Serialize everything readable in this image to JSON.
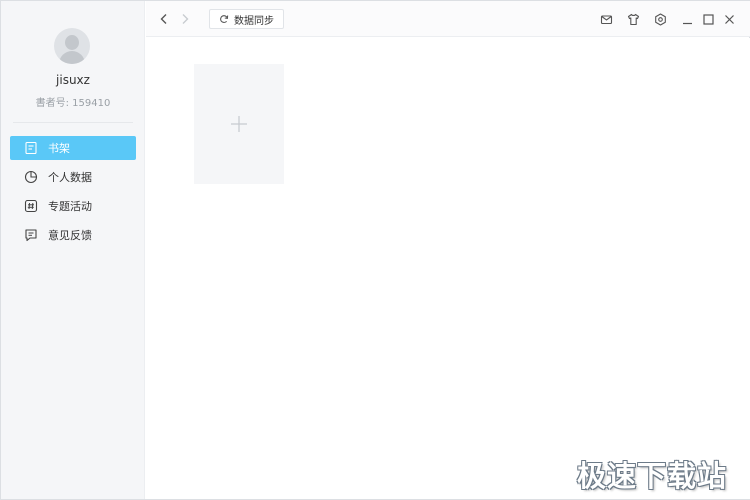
{
  "user": {
    "name": "jisuxz",
    "reader_id": "書者号: 159410"
  },
  "sidebar": {
    "items": [
      {
        "label": "书架",
        "icon": "bookshelf-icon",
        "active": true
      },
      {
        "label": "个人数据",
        "icon": "pie-chart-icon",
        "active": false
      },
      {
        "label": "专题活动",
        "icon": "hashtag-icon",
        "active": false
      },
      {
        "label": "意见反馈",
        "icon": "feedback-icon",
        "active": false
      }
    ]
  },
  "toolbar": {
    "sync_label": "数据同步",
    "icons": [
      "mail-icon",
      "tshirt-icon",
      "settings-icon",
      "minimize-icon",
      "maximize-icon",
      "close-icon"
    ]
  },
  "main": {
    "add_book_icon": "plus-icon"
  },
  "watermark": {
    "text": "极速下载站"
  },
  "colors": {
    "accent": "#5ac8f7",
    "sidebar_bg": "#f5f6f8",
    "icon_gray": "#6b7075",
    "disabled_gray": "#c8ccd0"
  }
}
